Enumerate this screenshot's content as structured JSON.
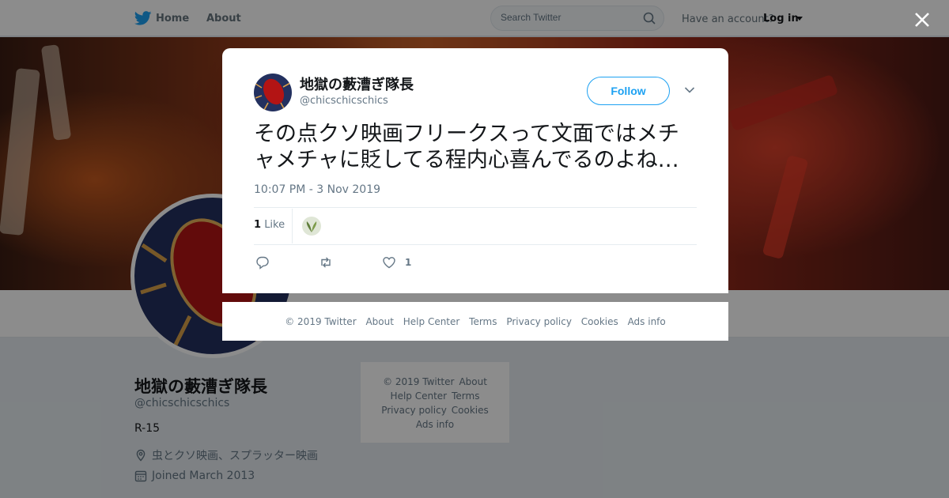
{
  "nav": {
    "home_label": "Home",
    "about_label": "About",
    "search_placeholder": "Search Twitter",
    "have_account": "Have an account?",
    "login_label": "Log in"
  },
  "profile": {
    "name": "地獄の藪漕ぎ隊長",
    "handle": "@chicschicschics",
    "bio": "R-15",
    "location": "虫とクソ映画、スプラッター映画",
    "joined": "Joined March 2013"
  },
  "side_footer": {
    "copyright": "© 2019 Twitter",
    "about": "About",
    "help": "Help Center",
    "terms": "Terms",
    "privacy": "Privacy policy",
    "cookies": "Cookies",
    "ads": "Ads info"
  },
  "tweet": {
    "author_name": "地獄の藪漕ぎ隊長",
    "author_handle": "@chicschicschics",
    "follow_label": "Follow",
    "text_line1": "その点クソ映画フリークスって文面ではメチ",
    "text_line2": "ャメチャに貶してる程内心喜んでるのよね…",
    "time": "10:07 PM - 3 Nov 2019",
    "likes_number": "1",
    "likes_label": "Like",
    "like_action_count": "1"
  },
  "modal_footer": {
    "copyright": "© 2019 Twitter",
    "about": "About",
    "help": "Help Center",
    "terms": "Terms",
    "privacy": "Privacy policy",
    "cookies": "Cookies",
    "ads": "Ads info"
  },
  "colors": {
    "accent": "#1da1f2",
    "text_secondary": "#657786",
    "overlay": "rgba(0,0,0,0.45)"
  },
  "icons": [
    "twitter-bird-icon",
    "home-icon",
    "search-icon",
    "caret-down-icon",
    "close-icon",
    "location-icon",
    "calendar-icon",
    "reply-icon",
    "retweet-icon",
    "heart-icon",
    "chevron-down-icon"
  ]
}
